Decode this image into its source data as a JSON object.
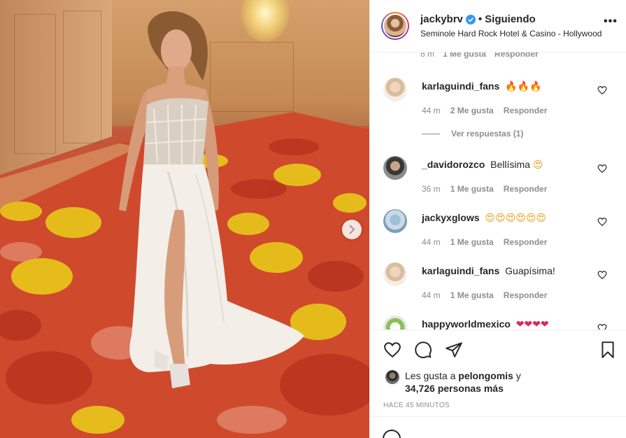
{
  "post": {
    "image_alt": "",
    "carousel_next_icon": "chevron-right-icon"
  },
  "header": {
    "username": "jackybrv",
    "verified_icon": "verified-badge-icon",
    "separator": "•",
    "follow_status": "Siguiendo",
    "location": "Seminole Hard Rock Hotel & Casino - Hollywood",
    "more_icon": "more-horizontal-icon"
  },
  "clipped_comment_meta": {
    "time": "8 m",
    "likes": "1 Me gusta",
    "reply": "Responder"
  },
  "comments": [
    {
      "username": "karlaguindi_fans",
      "text": "",
      "emoji": "🔥🔥🔥",
      "time": "44 m",
      "likes": "2 Me gusta",
      "reply": "Responder",
      "view_replies": "Ver respuestas (1)"
    },
    {
      "username": "_davidorozco",
      "text": "Bellísima",
      "emoji": "😍",
      "time": "36 m",
      "likes": "1 Me gusta",
      "reply": "Responder"
    },
    {
      "username": "jackyxglows",
      "text": "",
      "emoji": "😍😍😍😍😍😍",
      "time": "44 m",
      "likes": "1 Me gusta",
      "reply": "Responder"
    },
    {
      "username": "karlaguindi_fans",
      "text": "Guapísima!",
      "emoji": "",
      "time": "44 m",
      "likes": "1 Me gusta",
      "reply": "Responder"
    },
    {
      "username": "happyworldmexico",
      "text": "",
      "emoji": "❤❤❤❤"
    }
  ],
  "actions": {
    "like_icon": "heart-icon",
    "comment_icon": "comment-icon",
    "share_icon": "paper-plane-icon",
    "save_icon": "bookmark-icon"
  },
  "likes": {
    "prefix": "Les gusta a",
    "user": "pelongomis",
    "and": "y",
    "count_text": "34,726 personas más"
  },
  "timestamp": "HACE 45 MINUTOS",
  "colors": {
    "text": "#262626",
    "secondary": "#8e8e8e",
    "border": "#efefef",
    "verified": "#3897f0"
  }
}
